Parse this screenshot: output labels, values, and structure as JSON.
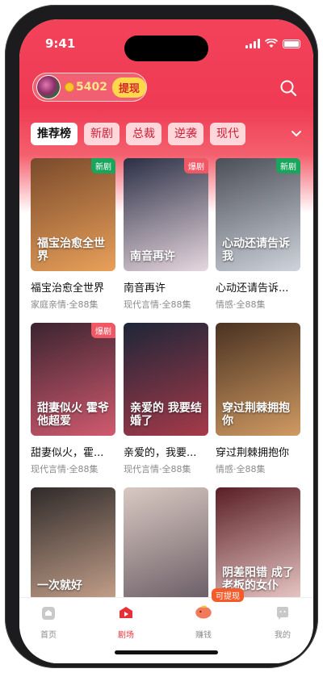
{
  "status_bar": {
    "time": "9:41"
  },
  "header": {
    "coins": "5402",
    "withdraw_label": "提现"
  },
  "tabs": [
    {
      "label": "推荐榜",
      "active": true
    },
    {
      "label": "新剧",
      "active": false
    },
    {
      "label": "总裁",
      "active": false
    },
    {
      "label": "逆袭",
      "active": false
    },
    {
      "label": "现代",
      "active": false
    }
  ],
  "dramas": [
    {
      "title": "福宝治愈全世界",
      "meta": "家庭亲情·全88集",
      "badge": "新剧",
      "poster_text": "福宝治愈全世界",
      "colors": [
        "#7a4a2b",
        "#e9a05a"
      ]
    },
    {
      "title": "南音再许",
      "meta": "现代言情·全88集",
      "badge": "爆剧",
      "poster_text": "南音再许",
      "colors": [
        "#2b2f45",
        "#e7d7df"
      ]
    },
    {
      "title": "心动还请告诉...",
      "meta": "情感·全88集",
      "badge": "新剧",
      "poster_text": "心动还请告诉我",
      "colors": [
        "#4b4e57",
        "#cfd3db"
      ]
    },
    {
      "title": "甜妻似火，霍...",
      "meta": "现代言情·全88集",
      "badge": "爆剧",
      "poster_text": "甜妻似火 霍爷他超爱",
      "colors": [
        "#3b2430",
        "#d15a6f"
      ]
    },
    {
      "title": "亲爱的，我要...",
      "meta": "现代言情·全88集",
      "badge": "",
      "poster_text": "亲爱的 我要结婚了",
      "colors": [
        "#1d2638",
        "#a63a4a"
      ]
    },
    {
      "title": "穿过荆棘拥抱你",
      "meta": "情感·全88集",
      "badge": "",
      "poster_text": "穿过荆棘拥抱你",
      "colors": [
        "#4a3222",
        "#d09a62"
      ]
    },
    {
      "title": "",
      "meta": "",
      "badge": "",
      "poster_text": "一次就好",
      "colors": [
        "#2f2a2a",
        "#c4a08a"
      ]
    },
    {
      "title": "",
      "meta": "",
      "badge": "",
      "poster_text": "",
      "colors": [
        "#d9c9c2",
        "#6b5d66"
      ]
    },
    {
      "title": "",
      "meta": "",
      "badge": "",
      "poster_text": "阴差阳错 成了老板的女仆",
      "colors": [
        "#5a1f25",
        "#e8c7c5"
      ]
    }
  ],
  "nav": [
    {
      "label": "首页",
      "icon": "home-icon"
    },
    {
      "label": "剧场",
      "icon": "theater-icon"
    },
    {
      "label": "赚钱",
      "icon": "piggy-bank-icon"
    },
    {
      "label": "我的",
      "icon": "profile-icon"
    }
  ],
  "earn_tag": "可提现"
}
